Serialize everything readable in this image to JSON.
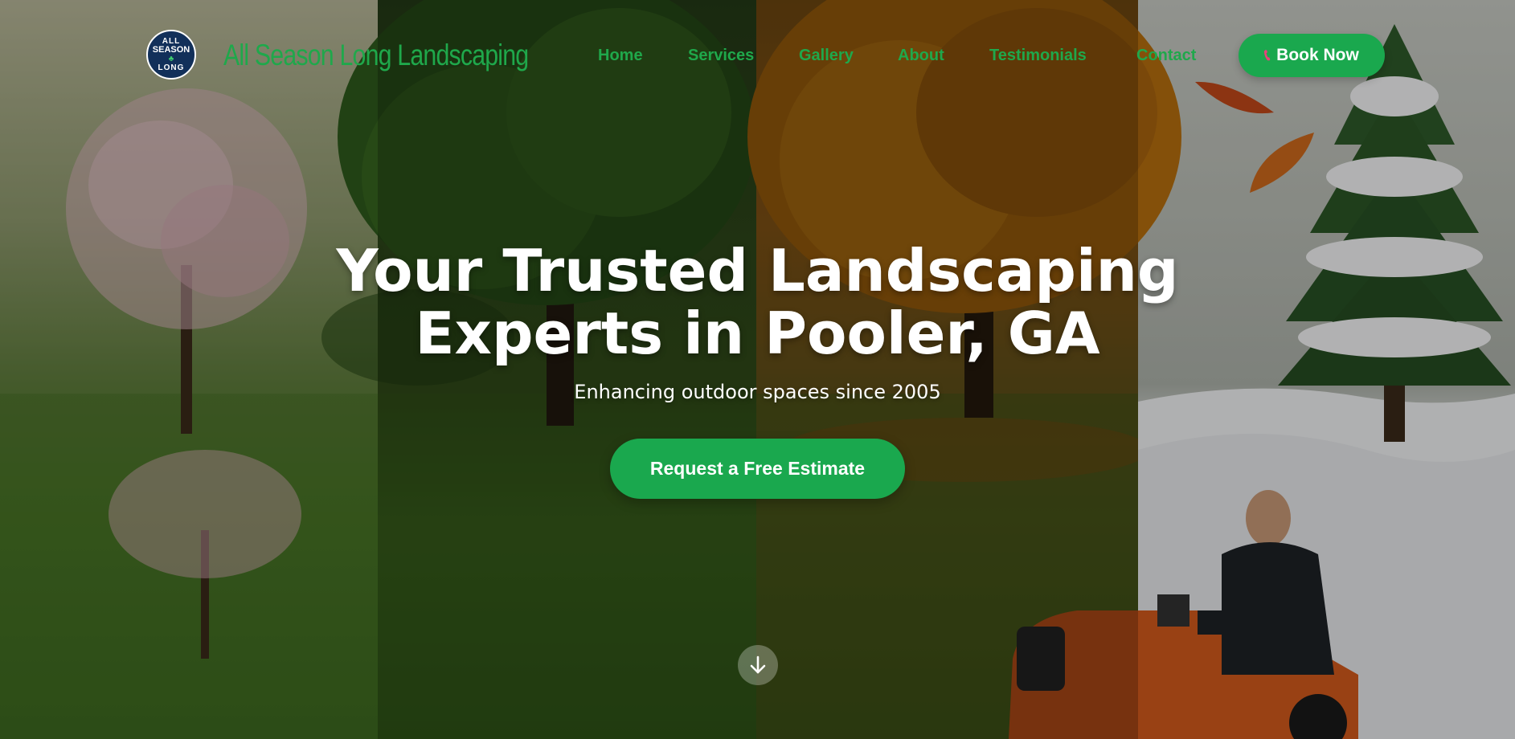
{
  "brand": {
    "logo_line1": "ALL",
    "logo_line2": "SEASON",
    "logo_line3": "LONG",
    "name": "All Season Long Landscaping"
  },
  "nav": {
    "items": [
      {
        "label": "Home"
      },
      {
        "label": "Services"
      },
      {
        "label": "Gallery"
      },
      {
        "label": "About"
      },
      {
        "label": "Testimonials"
      },
      {
        "label": "Contact"
      }
    ],
    "cta_label": "Book Now",
    "cta_icon": "phone-icon"
  },
  "hero": {
    "title_line1": "Your Trusted Landscaping",
    "title_line2": "Experts in Pooler, GA",
    "subtitle": "Enhancing outdoor spaces since 2005",
    "cta_label": "Request a Free Estimate",
    "scroll_icon": "arrow-down-icon"
  },
  "colors": {
    "brand_green": "#1aa84e",
    "text_green": "#1fa84b",
    "logo_navy": "#12305a",
    "phone_pink": "#e8427a"
  }
}
